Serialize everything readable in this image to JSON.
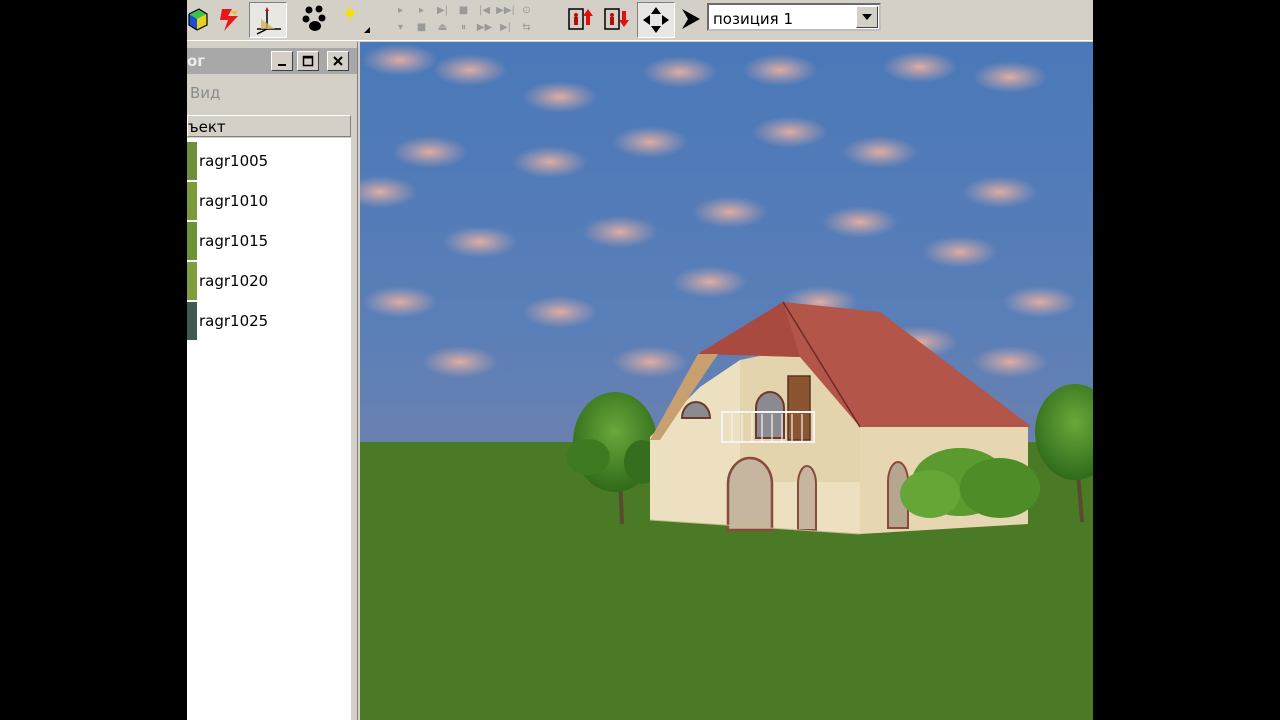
{
  "toolbar": {
    "icons": [
      "cube-icon",
      "lightning-icon",
      "axes-icon",
      "paw-icon",
      "sun-icon",
      "playback-controls",
      "elevator-up-icon",
      "elevator-down-icon",
      "navigate-icon",
      "arrow-icon"
    ],
    "position_select": "позиция 1"
  },
  "panel": {
    "title_fragment": "ог",
    "menu_view": "Вид",
    "column_header": "ъект",
    "items": [
      {
        "label": "ragr1005",
        "color": "#6f8f3a"
      },
      {
        "label": "ragr1010",
        "color": "#7a9a3c"
      },
      {
        "label": "ragr1015",
        "color": "#6c9437"
      },
      {
        "label": "ragr1020",
        "color": "#7f9d3f"
      },
      {
        "label": "ragr1025",
        "color": "#3e5a52"
      }
    ]
  },
  "scene": {
    "sky_color": "#4e7cb8",
    "ground_color": "#4a7a25",
    "roof_color": "#b4554a",
    "wall_color": "#e8d8b4"
  }
}
